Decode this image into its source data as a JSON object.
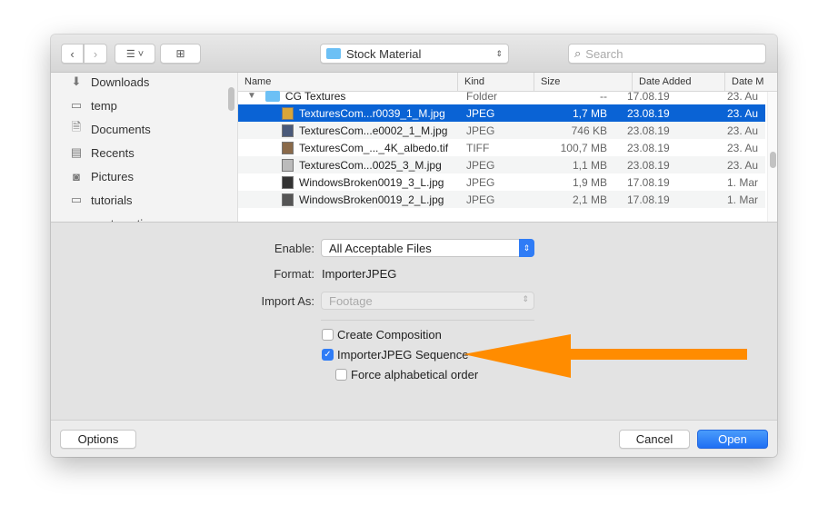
{
  "toolbar": {
    "location": "Stock Material",
    "search_placeholder": "Search"
  },
  "sidebar": {
    "items": [
      {
        "label": "Downloads",
        "icon": "download-icon"
      },
      {
        "label": "temp",
        "icon": "folder-icon"
      },
      {
        "label": "Documents",
        "icon": "document-icon"
      },
      {
        "label": "Recents",
        "icon": "recents-icon"
      },
      {
        "label": "Pictures",
        "icon": "camera-icon"
      },
      {
        "label": "tutorials",
        "icon": "folder-icon"
      },
      {
        "label": "_automation",
        "icon": "folder-icon"
      }
    ]
  },
  "list": {
    "columns": [
      "Name",
      "Kind",
      "Size",
      "Date Added",
      "Date M"
    ],
    "folder": {
      "name": "CG Textures",
      "kind": "Folder",
      "size": "--",
      "added": "17.08.19",
      "modified": "23. Au"
    },
    "rows": [
      {
        "name": "TexturesCom...r0039_1_M.jpg",
        "kind": "JPEG",
        "size": "1,7 MB",
        "added": "23.08.19",
        "modified": "23. Au",
        "thumb": "#d8a53a",
        "selected": true
      },
      {
        "name": "TexturesCom...e0002_1_M.jpg",
        "kind": "JPEG",
        "size": "746 KB",
        "added": "23.08.19",
        "modified": "23. Au",
        "thumb": "#4a5a7a"
      },
      {
        "name": "TexturesCom_..._4K_albedo.tif",
        "kind": "TIFF",
        "size": "100,7 MB",
        "added": "23.08.19",
        "modified": "23. Au",
        "thumb": "#8a6a4a"
      },
      {
        "name": "TexturesCom...0025_3_M.jpg",
        "kind": "JPEG",
        "size": "1,1 MB",
        "added": "23.08.19",
        "modified": "23. Au",
        "thumb": "#bbb"
      },
      {
        "name": "WindowsBroken0019_3_L.jpg",
        "kind": "JPEG",
        "size": "1,9 MB",
        "added": "17.08.19",
        "modified": "1. Mar",
        "thumb": "#333"
      },
      {
        "name": "WindowsBroken0019_2_L.jpg",
        "kind": "JPEG",
        "size": "2,1 MB",
        "added": "17.08.19",
        "modified": "1. Mar",
        "thumb": "#555"
      }
    ]
  },
  "options": {
    "enable_label": "Enable:",
    "enable_value": "All Acceptable Files",
    "format_label": "Format:",
    "format_value": "ImporterJPEG",
    "import_as_label": "Import As:",
    "import_as_value": "Footage",
    "create_composition": {
      "label": "Create Composition",
      "checked": false
    },
    "sequence": {
      "label": "ImporterJPEG Sequence",
      "checked": true
    },
    "alphabetical": {
      "label": "Force alphabetical order",
      "checked": false
    }
  },
  "footer": {
    "options": "Options",
    "cancel": "Cancel",
    "open": "Open"
  },
  "colors": {
    "accent": "#0a63d5",
    "arrow": "#ff8c00"
  }
}
